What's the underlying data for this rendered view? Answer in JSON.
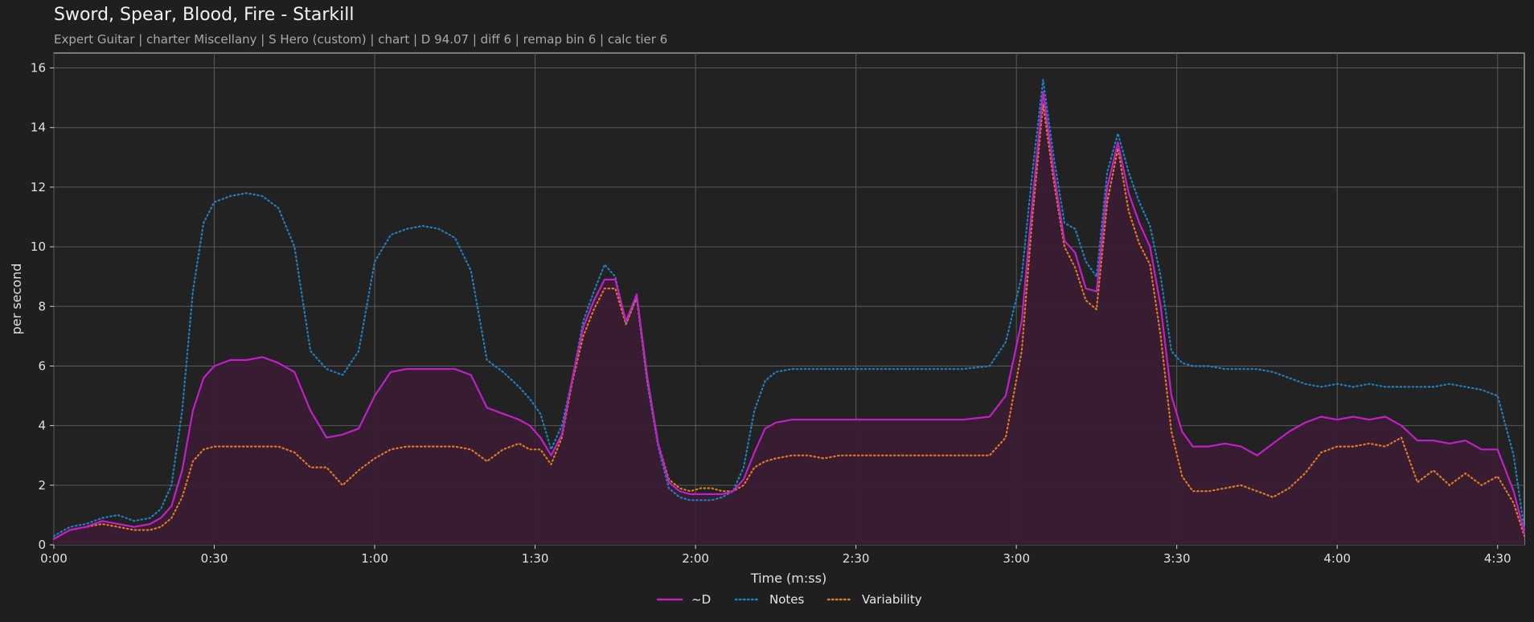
{
  "header": {
    "title": "Sword, Spear, Blood, Fire - Starkill",
    "subtitle": "Expert Guitar  |  charter Miscellany  |  S Hero (custom)  |  chart  |  D 94.07  |  diff 6  |  remap bin 6  |  calc tier 6"
  },
  "colors": {
    "background": "#1f1f1f",
    "plot_background": "#222222",
    "grid": "#5a5a5a",
    "d_line": "#c21fc8",
    "d_fill": "#3a1c34",
    "notes": "#1f7fc0",
    "variability": "#e07a20"
  },
  "chart_data": {
    "type": "line",
    "title": "",
    "xlabel": "Time (m:ss)",
    "ylabel": "per second",
    "xlim": [
      0,
      275
    ],
    "ylim": [
      0,
      16.5
    ],
    "grid": true,
    "legend_position": "bottom-center",
    "x_ticks": [
      0,
      30,
      60,
      90,
      120,
      150,
      180,
      210,
      240,
      270
    ],
    "x_tick_labels": [
      "0:00",
      "0:30",
      "1:00",
      "1:30",
      "2:00",
      "2:30",
      "3:00",
      "3:30",
      "4:00",
      "4:30"
    ],
    "y_ticks": [
      0,
      2,
      4,
      6,
      8,
      10,
      12,
      14,
      16
    ],
    "y_tick_labels": [
      "0",
      "2",
      "4",
      "6",
      "8",
      "10",
      "12",
      "14",
      "16"
    ],
    "x": [
      0,
      3,
      6,
      9,
      12,
      15,
      18,
      20,
      22,
      24,
      26,
      28,
      30,
      33,
      36,
      39,
      42,
      45,
      48,
      51,
      54,
      57,
      60,
      63,
      66,
      69,
      72,
      75,
      78,
      81,
      84,
      87,
      89,
      91,
      93,
      95,
      97,
      99,
      101,
      103,
      105,
      107,
      109,
      111,
      113,
      115,
      117,
      119,
      121,
      123,
      125,
      127,
      129,
      131,
      133,
      135,
      138,
      141,
      144,
      147,
      150,
      155,
      160,
      165,
      170,
      175,
      178,
      181,
      183,
      185,
      187,
      189,
      191,
      193,
      195,
      197,
      199,
      201,
      203,
      205,
      207,
      209,
      211,
      213,
      216,
      219,
      222,
      225,
      228,
      231,
      234,
      237,
      240,
      243,
      246,
      249,
      252,
      255,
      258,
      261,
      264,
      267,
      270,
      273,
      275
    ],
    "series": [
      {
        "name": "~D",
        "style": "solid",
        "values": [
          0.2,
          0.5,
          0.6,
          0.8,
          0.7,
          0.6,
          0.7,
          0.9,
          1.3,
          2.5,
          4.5,
          5.6,
          6.0,
          6.2,
          6.2,
          6.3,
          6.1,
          5.8,
          4.5,
          3.6,
          3.7,
          3.9,
          5.0,
          5.8,
          5.9,
          5.9,
          5.9,
          5.9,
          5.7,
          4.6,
          4.4,
          4.2,
          4.0,
          3.6,
          3.0,
          3.7,
          5.6,
          7.3,
          8.2,
          8.9,
          8.9,
          7.5,
          8.4,
          5.6,
          3.4,
          2.1,
          1.8,
          1.7,
          1.7,
          1.7,
          1.7,
          1.8,
          2.2,
          3.1,
          3.9,
          4.1,
          4.2,
          4.2,
          4.2,
          4.2,
          4.2,
          4.2,
          4.2,
          4.2,
          4.2,
          4.3,
          5.0,
          7.5,
          11.5,
          15.2,
          12.5,
          10.2,
          9.8,
          8.6,
          8.5,
          12.0,
          13.5,
          11.8,
          10.8,
          10.0,
          8.0,
          5.0,
          3.8,
          3.3,
          3.3,
          3.4,
          3.3,
          3.0,
          3.4,
          3.8,
          4.1,
          4.3,
          4.2,
          4.3,
          4.2,
          4.3,
          4.0,
          3.5,
          3.5,
          3.4,
          3.5,
          3.2,
          3.2,
          1.8,
          0.4
        ]
      },
      {
        "name": "Notes",
        "style": "dotted",
        "values": [
          0.3,
          0.6,
          0.7,
          0.9,
          1.0,
          0.8,
          0.9,
          1.2,
          2.0,
          4.5,
          8.5,
          10.8,
          11.5,
          11.7,
          11.8,
          11.7,
          11.3,
          10.0,
          6.5,
          5.9,
          5.7,
          6.5,
          9.5,
          10.4,
          10.6,
          10.7,
          10.6,
          10.3,
          9.2,
          6.2,
          5.8,
          5.3,
          4.9,
          4.4,
          3.2,
          4.0,
          5.6,
          7.5,
          8.5,
          9.4,
          9.0,
          7.4,
          8.3,
          5.4,
          3.3,
          1.9,
          1.6,
          1.5,
          1.5,
          1.5,
          1.6,
          1.8,
          2.6,
          4.5,
          5.5,
          5.8,
          5.9,
          5.9,
          5.9,
          5.9,
          5.9,
          5.9,
          5.9,
          5.9,
          5.9,
          6.0,
          6.8,
          9.0,
          12.5,
          15.6,
          13.0,
          10.8,
          10.6,
          9.5,
          9.0,
          12.5,
          13.8,
          12.5,
          11.5,
          10.7,
          9.0,
          6.5,
          6.1,
          6.0,
          6.0,
          5.9,
          5.9,
          5.9,
          5.8,
          5.6,
          5.4,
          5.3,
          5.4,
          5.3,
          5.4,
          5.3,
          5.3,
          5.3,
          5.3,
          5.4,
          5.3,
          5.2,
          5.0,
          3.0,
          0.5
        ]
      },
      {
        "name": "Variability",
        "style": "dotted",
        "values": [
          0.2,
          0.5,
          0.6,
          0.7,
          0.6,
          0.5,
          0.5,
          0.6,
          0.9,
          1.6,
          2.8,
          3.2,
          3.3,
          3.3,
          3.3,
          3.3,
          3.3,
          3.1,
          2.6,
          2.6,
          2.0,
          2.5,
          2.9,
          3.2,
          3.3,
          3.3,
          3.3,
          3.3,
          3.2,
          2.8,
          3.2,
          3.4,
          3.2,
          3.2,
          2.7,
          3.6,
          5.5,
          7.0,
          7.9,
          8.6,
          8.6,
          7.4,
          8.3,
          5.5,
          3.4,
          2.2,
          1.9,
          1.8,
          1.9,
          1.9,
          1.8,
          1.8,
          2.0,
          2.6,
          2.8,
          2.9,
          3.0,
          3.0,
          2.9,
          3.0,
          3.0,
          3.0,
          3.0,
          3.0,
          3.0,
          3.0,
          3.6,
          6.5,
          11.0,
          14.8,
          12.2,
          10.0,
          9.3,
          8.2,
          7.9,
          11.5,
          13.3,
          11.2,
          10.1,
          9.4,
          7.0,
          3.8,
          2.3,
          1.8,
          1.8,
          1.9,
          2.0,
          1.8,
          1.6,
          1.9,
          2.4,
          3.1,
          3.3,
          3.3,
          3.4,
          3.3,
          3.6,
          2.1,
          2.5,
          2.0,
          2.4,
          2.0,
          2.3,
          1.4,
          0.3
        ]
      }
    ],
    "legend": [
      "~D",
      "Notes",
      "Variability"
    ]
  }
}
